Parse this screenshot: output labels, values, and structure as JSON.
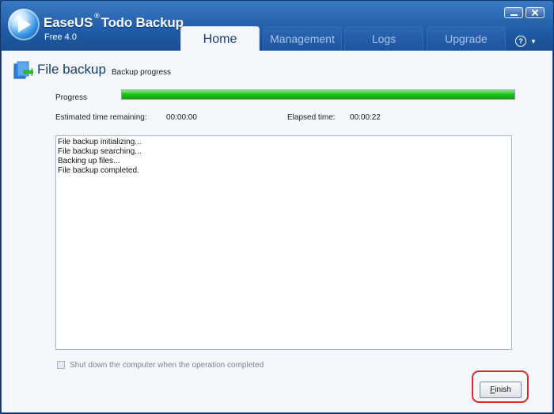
{
  "app": {
    "name_part1": "EaseUS",
    "registered": "®",
    "name_part2": "Todo Backup",
    "version": "Free 4.0"
  },
  "tabs": [
    {
      "label": "Home",
      "active": true
    },
    {
      "label": "Management",
      "active": false
    },
    {
      "label": "Logs",
      "active": false
    },
    {
      "label": "Upgrade",
      "active": false
    }
  ],
  "help": {
    "label": "?",
    "caret": "▼"
  },
  "page": {
    "title": "File backup",
    "subtitle": "Backup progress"
  },
  "progress": {
    "label": "Progress",
    "value_percent": 100
  },
  "time": {
    "remaining_label": "Estimated time remaining:",
    "remaining_value": "00:00:00",
    "elapsed_label": "Elapsed time:",
    "elapsed_value": "00:00:22"
  },
  "log": {
    "lines": [
      "File backup initializing...",
      "File backup searching...",
      "Backing up files...",
      "File backup completed."
    ]
  },
  "options": {
    "shutdown_label": "Shut down the computer when the operation completed",
    "shutdown_checked": false
  },
  "buttons": {
    "finish_mnemonic": "F",
    "finish_rest": "inish"
  },
  "colors": {
    "accent": "#1f5aa6",
    "progress": "#21c21b",
    "highlight": "#e02a2a"
  }
}
